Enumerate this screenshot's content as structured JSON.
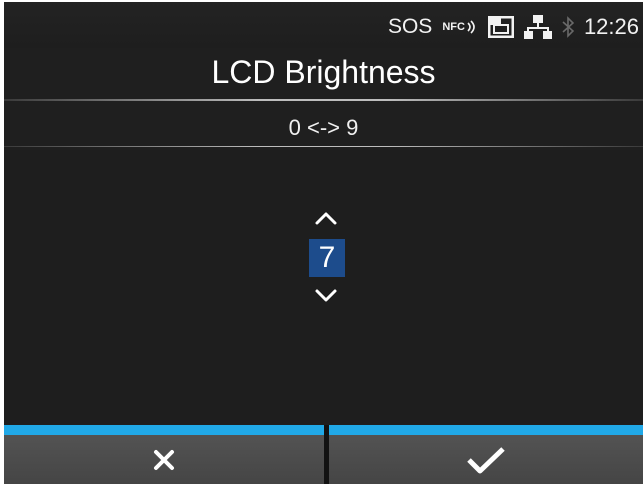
{
  "statusbar": {
    "sos": "SOS",
    "nfc": "NFC",
    "time": "12:26",
    "icons": [
      "nfc-icon",
      "sd-card-icon",
      "network-icon",
      "bluetooth-icon"
    ]
  },
  "title": "LCD Brightness",
  "range": "0 <-> 9",
  "setting": {
    "value": "7",
    "min": 0,
    "max": 9
  },
  "buttons": {
    "cancel_icon": "close-icon",
    "confirm_icon": "checkmark-icon"
  },
  "colors": {
    "background": "#1f1f1f",
    "accent_bar": "#21a9e8",
    "value_highlight": "#1d4c8c",
    "button": "#4d4d4d"
  }
}
